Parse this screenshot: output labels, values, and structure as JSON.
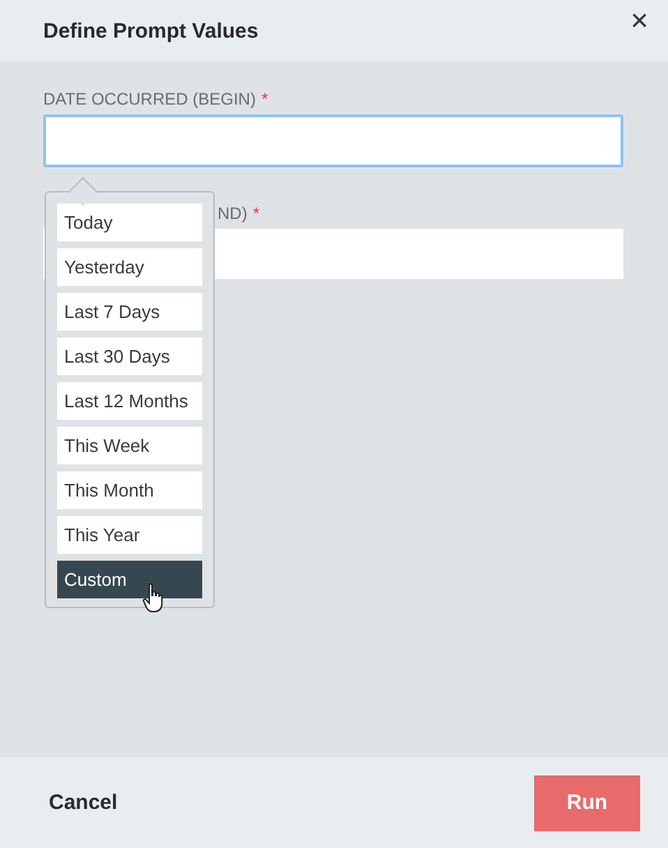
{
  "dialog": {
    "title": "Define Prompt Values",
    "close": "×"
  },
  "fields": [
    {
      "label": "DATE OCCURRED (BEGIN)",
      "required_mark": "*",
      "focused": true
    },
    {
      "label": "ND)",
      "required_mark": "*",
      "focused": false
    }
  ],
  "dropdown": {
    "items": [
      {
        "label": "Today",
        "selected": false
      },
      {
        "label": "Yesterday",
        "selected": false
      },
      {
        "label": "Last 7 Days",
        "selected": false
      },
      {
        "label": "Last 30 Days",
        "selected": false
      },
      {
        "label": "Last 12 Months",
        "selected": false
      },
      {
        "label": "This Week",
        "selected": false
      },
      {
        "label": "This Month",
        "selected": false
      },
      {
        "label": "This Year",
        "selected": false
      },
      {
        "label": "Custom",
        "selected": true
      }
    ]
  },
  "footer": {
    "cancel": "Cancel",
    "run": "Run"
  }
}
